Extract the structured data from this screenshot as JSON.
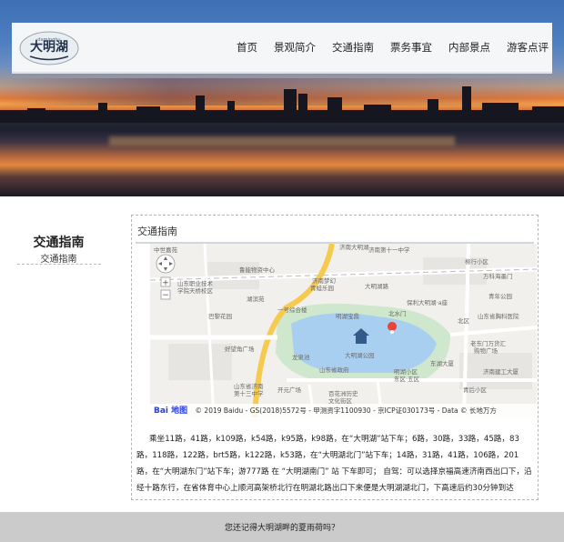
{
  "logo": {
    "name": "大明湖",
    "pinyin": "daminghu"
  },
  "nav": {
    "items": [
      "首页",
      "景观简介",
      "交通指南",
      "票务事宜",
      "内部景点",
      "游客点评"
    ]
  },
  "sidebar": {
    "title": "交通指南",
    "subtitle": "交通指南"
  },
  "panel": {
    "title": "交通指南"
  },
  "map": {
    "copyright": "© 2019 Baidu - GS(2018)5572号 - 甲测资字1100930 - 京ICP证030173号 - Data © 长地万方",
    "baidu_label": "Bai 地图",
    "labels": {
      "l1": "中世嘉苑",
      "l2": "鲁能物资中心",
      "l3": "济南大明湖",
      "l4": "山东职业技术",
      "l5": "学院天桥校区",
      "l6": "济南梦幻",
      "l7": "青蛙乐园",
      "l8": "湖滨苑",
      "l9": "一号综合楼",
      "l10": "巴黎花园",
      "l11": "明湖宝鼎",
      "l12": "北水门",
      "l13": "大明湖路",
      "l14": "大明湖公园",
      "l15": "龙泉池",
      "l16": "好望角广场",
      "l17": "山东省政府",
      "l18": "山东省济南",
      "l19": "第十三中学",
      "l20": "开元广场",
      "l21": "百花洲历史",
      "l22": "文化街区",
      "l23": "明湖小区",
      "l24": "东区·五区",
      "l25": "东湖大厦",
      "l26": "北区",
      "l27": "山东省胸科医院",
      "l28": "保利大明湖·a座",
      "l29": "老东门万货汇",
      "l30": "购物广场",
      "l31": "济南建工大厦",
      "l32": "万科海墨门",
      "l33": "柳行小区",
      "l34": "青年公园",
      "l35": "青后小区",
      "l36": "济南第十一中学"
    }
  },
  "directions": "乘坐11路，41路，k109路，k54路，k95路，k98路，在“大明湖”站下车；6路，30路，33路，45路，83路，118路，122路，brt5路，k122路，k53路，在“大明湖北门”站下车；14路，31路，41路，106路，201路，在“大明湖东门”站下车；游777路 在 “大明湖南门” 站 下车即可； 自驾：可以选择京福高速济南西出口下，沿经十路东行，在省体育中心上顺河高架桥北行在明湖北路出口下来便是大明湖湖北门，下高速后约30分钟到达",
  "footer": {
    "text": "您还记得大明湖畔的夏雨荷吗？"
  },
  "colors": {
    "nav_bg": "#f4f6f8",
    "footer_bg": "#cbcbcb",
    "lake": "#a9cff0",
    "map_pin": "#e8443a"
  }
}
